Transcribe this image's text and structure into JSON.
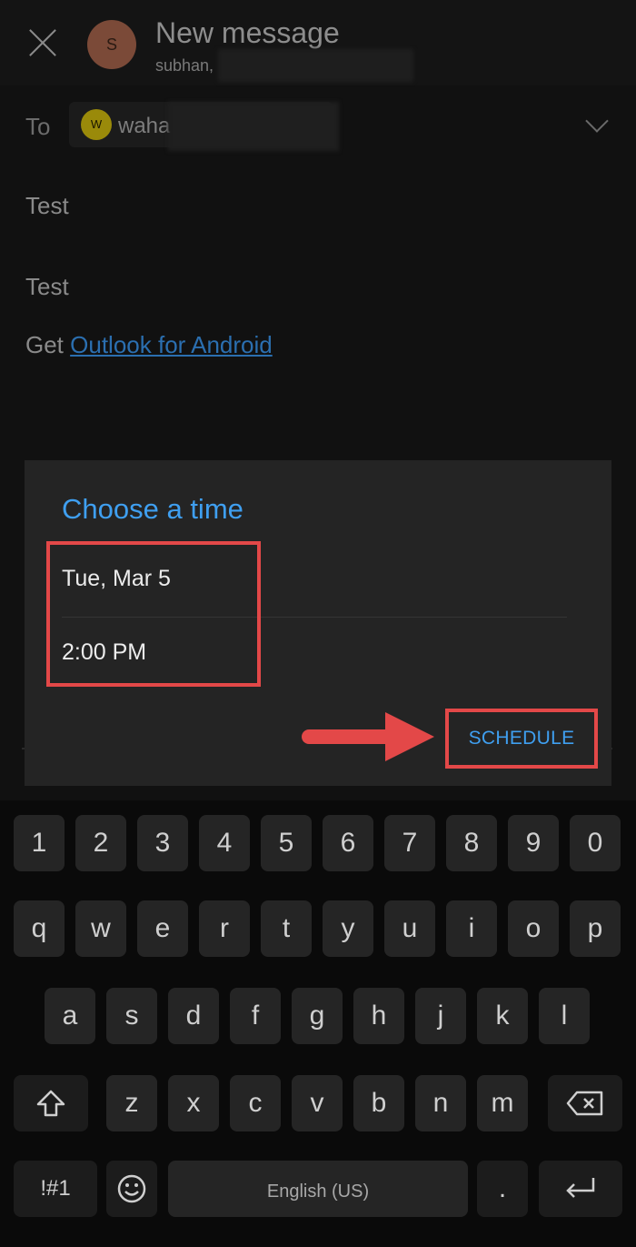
{
  "header": {
    "close_icon": "close-icon",
    "avatar_letter": "S",
    "title": "New message",
    "from": "subhan,"
  },
  "recipients": {
    "to_label": "To",
    "chip_letter": "W",
    "chip_name": "waha",
    "expand_icon": "chevron-down-icon"
  },
  "message": {
    "subject": "Test",
    "body": "Test",
    "signature_prefix": "Get ",
    "signature_link": "Outlook for Android"
  },
  "dialog": {
    "title": "Choose a time",
    "date": "Tue, Mar 5",
    "time": "2:00 PM",
    "action": "SCHEDULE"
  },
  "keyboard": {
    "row_numbers": [
      "1",
      "2",
      "3",
      "4",
      "5",
      "6",
      "7",
      "8",
      "9",
      "0"
    ],
    "row1": [
      "q",
      "w",
      "e",
      "r",
      "t",
      "y",
      "u",
      "i",
      "o",
      "p"
    ],
    "row2": [
      "a",
      "s",
      "d",
      "f",
      "g",
      "h",
      "j",
      "k",
      "l"
    ],
    "row3": [
      "z",
      "x",
      "c",
      "v",
      "b",
      "n",
      "m"
    ],
    "shift_icon": "shift-icon",
    "backspace_icon": "backspace-icon",
    "symbols": "!#1",
    "emoji_icon": "emoji-icon",
    "space_label": "English (US)",
    "period": ".",
    "enter_icon": "enter-icon"
  },
  "colors": {
    "accent": "#3f9ff0",
    "highlight": "#e34848",
    "link": "#2b6fb0"
  }
}
